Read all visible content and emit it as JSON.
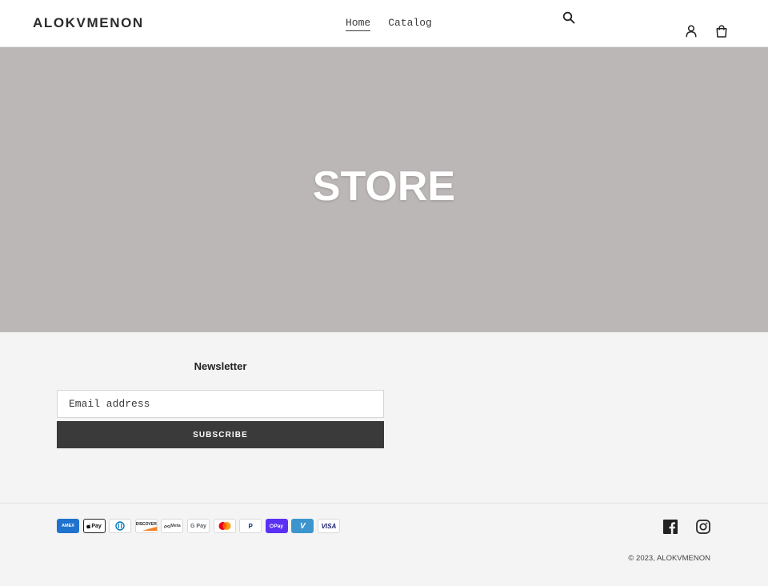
{
  "header": {
    "logo": "ALOKVMENON",
    "nav": [
      {
        "label": "Home",
        "active": true
      },
      {
        "label": "Catalog",
        "active": false
      }
    ],
    "icons": [
      "search-icon",
      "account-icon",
      "cart-icon"
    ]
  },
  "hero": {
    "title": "STORE",
    "background_color": "#bcb7b7"
  },
  "newsletter": {
    "heading": "Newsletter",
    "email_placeholder": "Email address",
    "subscribe_label": "SUBSCRIBE"
  },
  "payments": {
    "amex": "AMEX",
    "applepay": "Pay",
    "diners": "D",
    "discover": "DISCOVER",
    "meta": "Meta",
    "gpay": "G Pay",
    "paypal": "P",
    "shoppay": "Pay",
    "venmo": "V",
    "visa": "VISA"
  },
  "social": [
    "facebook-icon",
    "instagram-icon"
  ],
  "copyright": {
    "prefix": "© 2023, ",
    "brand": "ALOKVMENON"
  },
  "colors": {
    "button_dark": "#3a3a3a",
    "footer_bg": "#f4f4f4"
  }
}
